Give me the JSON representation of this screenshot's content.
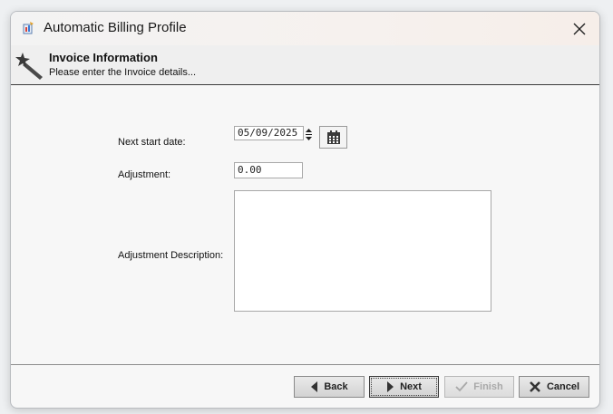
{
  "window": {
    "title": "Automatic Billing Profile",
    "app_icon": "billing-app-icon",
    "close_icon": "close-icon"
  },
  "header": {
    "icon": "magic-wand-icon",
    "title": "Invoice Information",
    "subtitle": "Please enter the Invoice details..."
  },
  "form": {
    "next_start_date": {
      "label": "Next start date:",
      "value": "05/09/2025"
    },
    "adjustment": {
      "label": "Adjustment:",
      "value": "0.00"
    },
    "adjustment_description": {
      "label": "Adjustment Description:",
      "value": ""
    }
  },
  "buttons": {
    "back": "Back",
    "next": "Next",
    "finish": "Finish",
    "cancel": "Cancel"
  },
  "colors": {
    "accent_dark": "#3b3b3b",
    "disabled_text": "#a8a8a8"
  }
}
